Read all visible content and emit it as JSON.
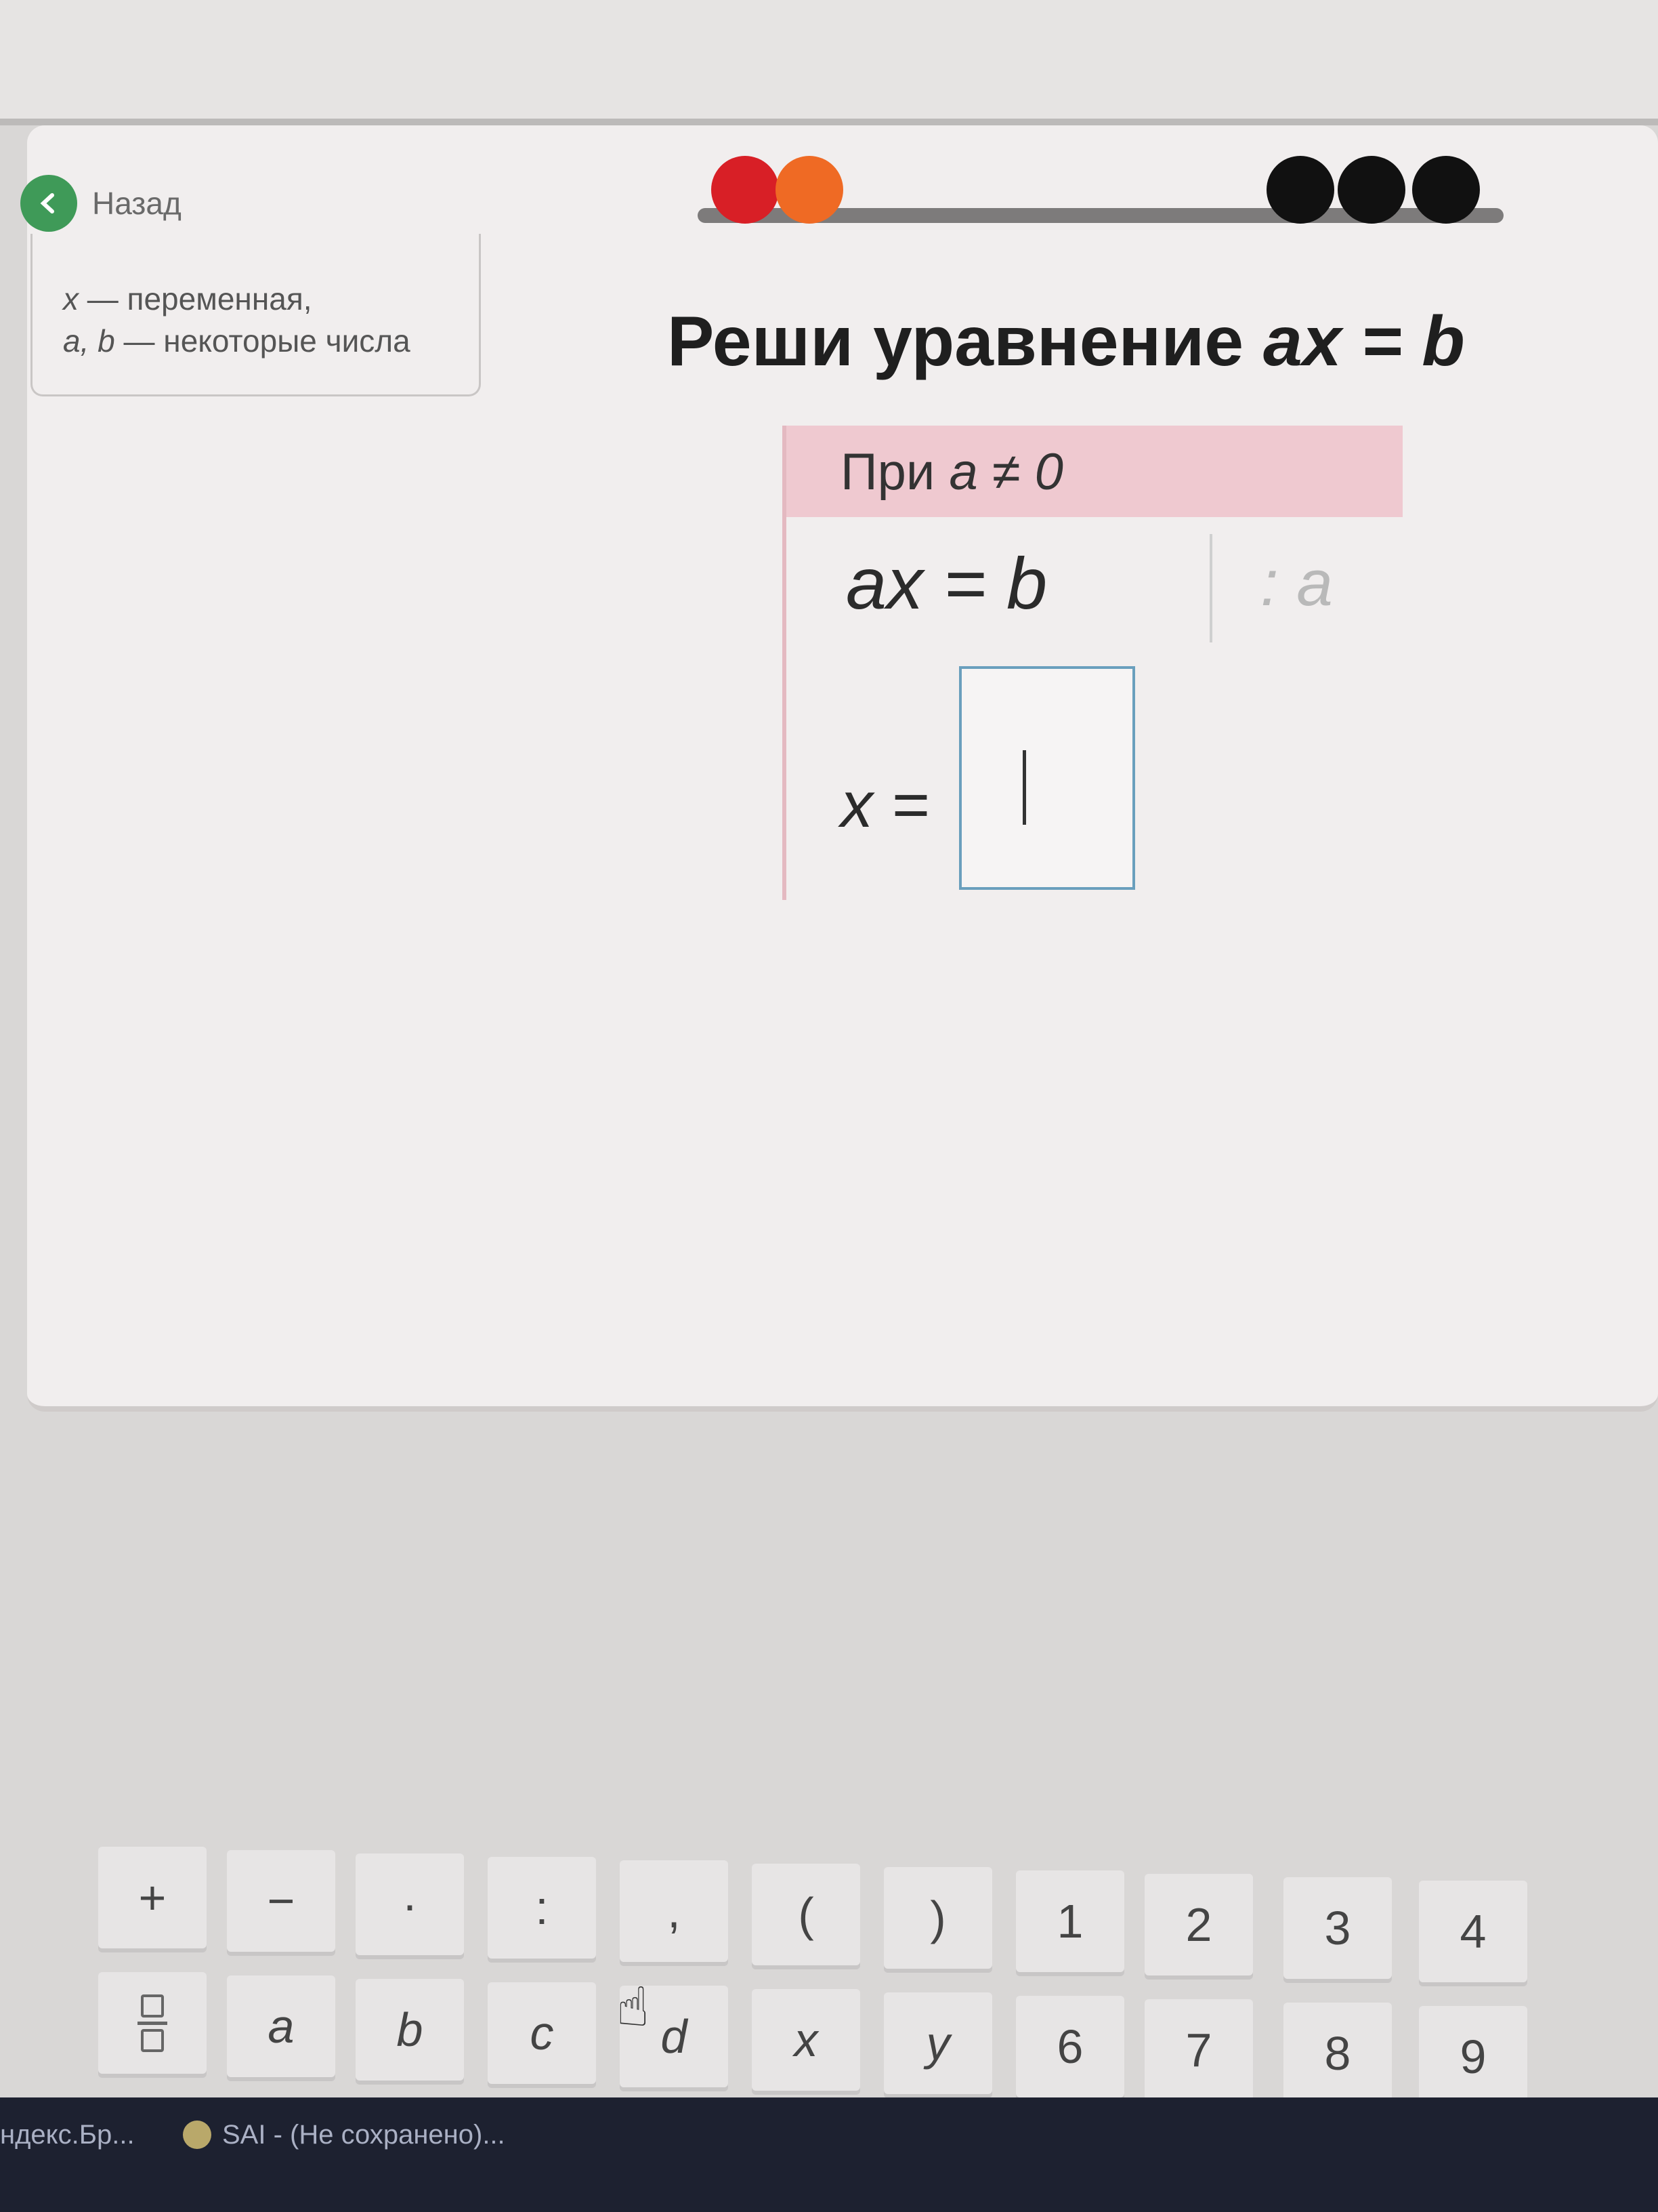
{
  "nav": {
    "back_label": "Назад"
  },
  "hint": {
    "line1_var": "x",
    "line1_rest": " — переменная,",
    "line2_vars": "a, b",
    "line2_rest": " — некоторые числа"
  },
  "progress": {
    "dots": [
      {
        "state": "done",
        "color": "#d81f26"
      },
      {
        "state": "current",
        "color": "#ef6a24"
      },
      {
        "state": "pending",
        "color": "#111111"
      },
      {
        "state": "pending",
        "color": "#111111"
      },
      {
        "state": "pending",
        "color": "#111111"
      }
    ]
  },
  "task": {
    "title_text": "Реши уравнение ",
    "title_eq": "ax = b",
    "condition_prefix": "При ",
    "condition_expr": "a ≠ 0",
    "equation": "ax = b",
    "operation": ": a",
    "answer_prefix": "x =",
    "answer_value": ""
  },
  "keyboard": {
    "row1": [
      "+",
      "−",
      "·",
      ":",
      ",",
      "(",
      ")",
      "1",
      "2",
      "3",
      "4"
    ],
    "row2": [
      "fraction",
      "a",
      "b",
      "c",
      "d",
      "x",
      "y",
      "6",
      "7",
      "8",
      "9"
    ]
  },
  "taskbar": {
    "item1": "ндекс.Бр...",
    "item2": "SAI - (Не сохранено)..."
  },
  "colors": {
    "accent_green": "#3f9a58",
    "condition_bg": "#efc9d0",
    "answer_border": "#6a9fbd"
  }
}
